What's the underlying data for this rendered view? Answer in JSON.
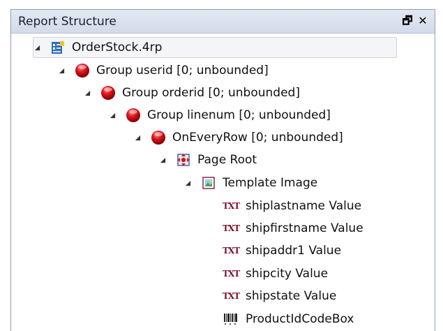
{
  "panel": {
    "title": "Report Structure",
    "pin_glyph": "🗗",
    "close_glyph": "✕"
  },
  "tree": {
    "root": {
      "label": "OrderStock.4rp",
      "icon": "report-file-icon"
    },
    "group_userid": {
      "label": "Group userid [0; unbounded]",
      "icon": "red-sphere-icon"
    },
    "group_orderid": {
      "label": "Group orderid [0; unbounded]",
      "icon": "red-sphere-icon"
    },
    "group_linenum": {
      "label": "Group linenum [0; unbounded]",
      "icon": "red-sphere-icon"
    },
    "on_every_row": {
      "label": "OnEveryRow [0; unbounded]",
      "icon": "red-sphere-icon"
    },
    "page_root": {
      "label": "Page Root",
      "icon": "page-root-icon"
    },
    "template_image": {
      "label": "Template Image",
      "icon": "image-icon"
    },
    "txt_badge": "TXT",
    "fields": [
      {
        "label": "shiplastname Value",
        "icon": "txt-icon"
      },
      {
        "label": "shipfirstname Value",
        "icon": "txt-icon"
      },
      {
        "label": "shipaddr1 Value",
        "icon": "txt-icon"
      },
      {
        "label": "shipcity Value",
        "icon": "txt-icon"
      },
      {
        "label": "shipstate Value",
        "icon": "txt-icon"
      }
    ],
    "barcode": {
      "label": "ProductIdCodeBox",
      "icon": "barcode-icon"
    }
  },
  "colors": {
    "sphere_red": "#d8141c",
    "txt_color": "#7b1530",
    "title_bar": "#dbe2ee",
    "border": "#8e9db8"
  }
}
